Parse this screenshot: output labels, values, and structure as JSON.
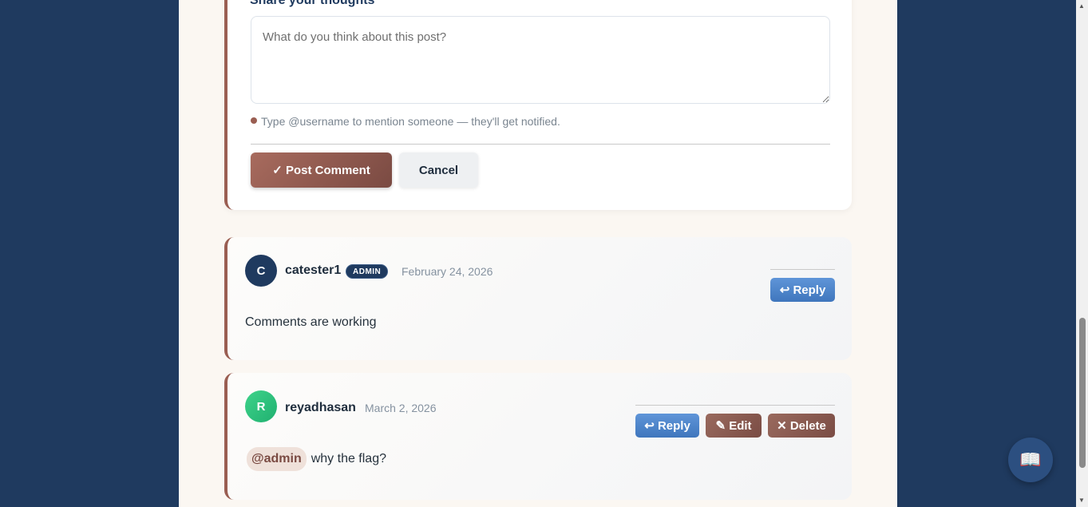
{
  "form": {
    "label": "Share your thoughts",
    "placeholder": "What do you think about this post?",
    "hint": "Type @username to mention someone — they'll get notified.",
    "post_label": "✓ Post Comment",
    "cancel_label": "Cancel"
  },
  "comments": [
    {
      "avatar_letter": "C",
      "username": "catester1",
      "badge": "ADMIN",
      "date": "February 24, 2026",
      "text": "Comments are working",
      "reply_label": "↩ Reply"
    },
    {
      "avatar_letter": "R",
      "username": "reyadhasan",
      "date": "March 2, 2026",
      "mention": "@admin",
      "text": "why the flag?",
      "reply_label": "↩ Reply",
      "edit_label": "✎ Edit",
      "delete_label": "✕ Delete"
    }
  ],
  "fab": {
    "icon": "book-icon",
    "glyph": "📖"
  }
}
